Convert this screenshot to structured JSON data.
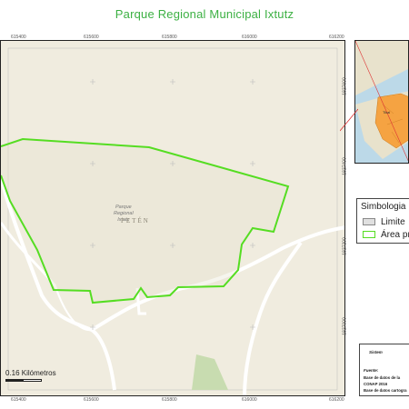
{
  "title": "Parque Regional Municipal Ixtutz",
  "map": {
    "area_label_line1": "Parque",
    "area_label_line2": "Regional",
    "area_label_line3": "Ixtutz",
    "region_label": "PETÉN",
    "top_ticks": [
      "615400",
      "615600",
      "615800",
      "616000",
      "616200"
    ],
    "bottom_ticks": [
      "615400",
      "615600",
      "615800",
      "616000",
      "616200"
    ],
    "right_ticks": [
      "1827600",
      "1827400",
      "1827200",
      "1827000"
    ],
    "scale_label": "0.16 Kilómetros",
    "colors": {
      "boundary": "#55dd22",
      "basemap": "#f0ecdf",
      "road": "#ffffff",
      "forest": "#c8dcb0"
    }
  },
  "inset": {
    "place_label": "Tikal",
    "colors": {
      "water": "#bcd9e8",
      "land": "#e8e2cc",
      "departments": "#f5a342"
    }
  },
  "legend": {
    "title": "Simbologia",
    "items": [
      {
        "label": "Limite",
        "color": "#e0e0e0",
        "border": "#888888"
      },
      {
        "label": "Área pr",
        "color": "#ffffff",
        "border": "#55dd22"
      }
    ]
  },
  "source_box": {
    "sistema": "Sistem",
    "fuente": "Fuente:",
    "line1": "Base de datos de la",
    "line2": "CONAP 2016",
    "line3": "Base de datos cartogra"
  }
}
